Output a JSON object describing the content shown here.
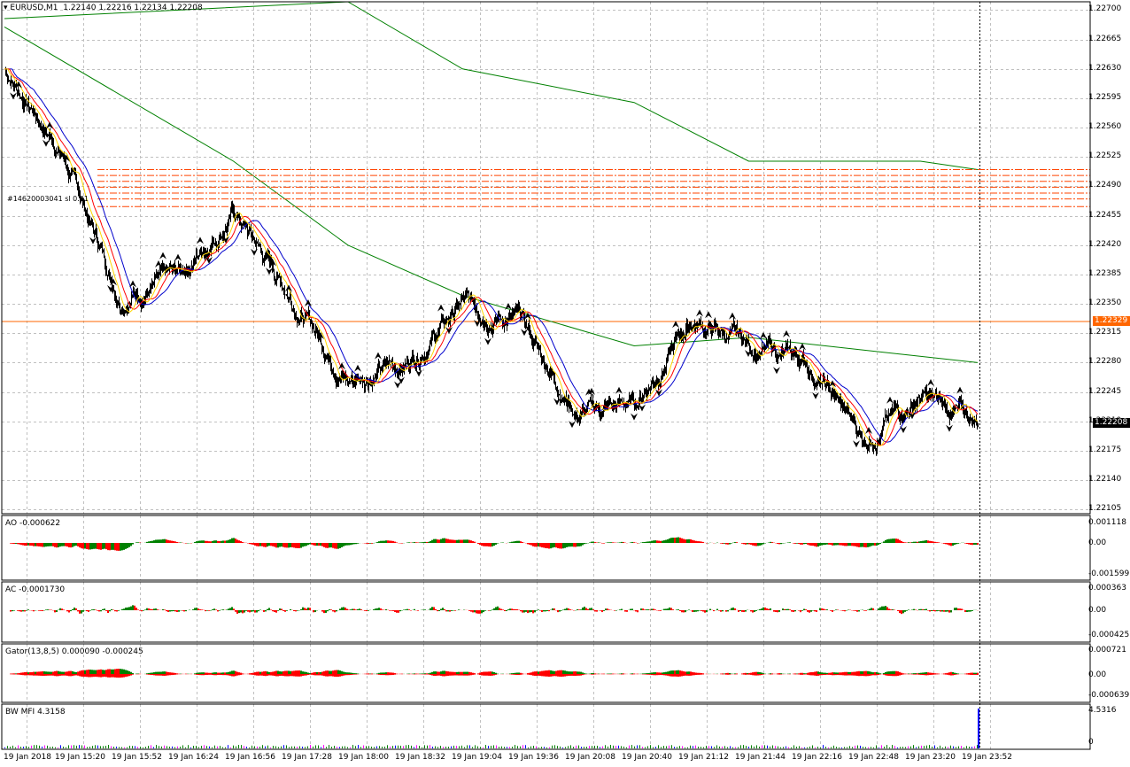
{
  "header": {
    "symbol": "EURUSD,M1",
    "ohlc": "1.22140 1.22216 1.22134 1.22208"
  },
  "price_axis": [
    "1.22700",
    "1.22665",
    "1.22630",
    "1.22595",
    "1.22560",
    "1.22525",
    "1.22490",
    "1.22455",
    "1.22420",
    "1.22385",
    "1.22350",
    "1.22315",
    "1.22280",
    "1.22245",
    "1.22210",
    "1.22175",
    "1.22140",
    "1.22105"
  ],
  "tags": {
    "red_line": "1.22329",
    "current": "1.22208"
  },
  "order_labels": [
    "#14620003041 sl 0.01"
  ],
  "indicators": {
    "ao": {
      "label": "AO -0.000622",
      "ticks": [
        "0.001118",
        "0.00",
        "-0.001599"
      ]
    },
    "ac": {
      "label": "AC -0.0001730",
      "ticks": [
        "0.000363",
        "0.00",
        "-0.000425"
      ]
    },
    "gator": {
      "label": "Gator(13,8,5) 0.000090 -0.000245",
      "ticks": [
        "0.000721",
        "0.00",
        "-0.000639"
      ]
    },
    "mfi": {
      "label": "BW MFI 4.3158",
      "ticks": [
        "4.5316",
        "0"
      ]
    }
  },
  "time_axis": [
    "19 Jan 2018",
    "19 Jan 15:20",
    "19 Jan 15:52",
    "19 Jan 16:24",
    "19 Jan 16:56",
    "19 Jan 17:28",
    "19 Jan 18:00",
    "19 Jan 18:32",
    "19 Jan 19:04",
    "19 Jan 19:36",
    "19 Jan 20:08",
    "19 Jan 20:40",
    "19 Jan 21:12",
    "19 Jan 21:44",
    "19 Jan 22:16",
    "19 Jan 22:48",
    "19 Jan 23:20",
    "19 Jan 23:52"
  ],
  "colors": {
    "bull": "#008000",
    "bear": "#ff0000",
    "jaw": "#0000cc",
    "teeth": "#ff0000",
    "lips": "#ffd700",
    "envelope": "#008000",
    "hline": "#ff6600",
    "orders": "#ff4400",
    "mfi": "#0000ff"
  },
  "chart_data": {
    "type": "line",
    "title": "EURUSD,M1",
    "ylim": [
      1.221,
      1.2271
    ],
    "series": [
      {
        "name": "EURUSD",
        "x": [
          "19 Jan 2018",
          "19 Jan 15:20",
          "19 Jan 15:52",
          "19 Jan 16:24",
          "19 Jan 16:56",
          "19 Jan 17:28",
          "19 Jan 18:00",
          "19 Jan 18:32",
          "19 Jan 19:04",
          "19 Jan 19:36",
          "19 Jan 20:08",
          "19 Jan 20:40",
          "19 Jan 21:12",
          "19 Jan 21:44",
          "19 Jan 22:16",
          "19 Jan 22:48",
          "19 Jan 23:20",
          "19 Jan 23:52"
        ],
        "values": [
          1.2263,
          1.2253,
          1.2236,
          1.2238,
          1.2246,
          1.2236,
          1.2226,
          1.2228,
          1.2235,
          1.2233,
          1.2222,
          1.2223,
          1.2233,
          1.223,
          1.2228,
          1.2219,
          1.2224,
          1.22208
        ]
      }
    ],
    "hline": 1.22329,
    "order_levels": [
      1.2251,
      1.22503,
      1.22496,
      1.22489,
      1.22482,
      1.22475,
      1.22466
    ],
    "envelope_upper": [
      [
        0,
        1.2269
      ],
      [
        6,
        1.2271
      ],
      [
        8,
        1.2263
      ],
      [
        11,
        1.2259
      ],
      [
        13,
        1.2252
      ],
      [
        16,
        1.2252
      ],
      [
        17,
        1.2251
      ]
    ],
    "ma_long": [
      [
        0,
        1.2268
      ],
      [
        4,
        1.2252
      ],
      [
        6,
        1.2242
      ],
      [
        8,
        1.2236
      ],
      [
        11,
        1.223
      ],
      [
        13,
        1.2231
      ],
      [
        17,
        1.2228
      ]
    ],
    "grid": true
  }
}
